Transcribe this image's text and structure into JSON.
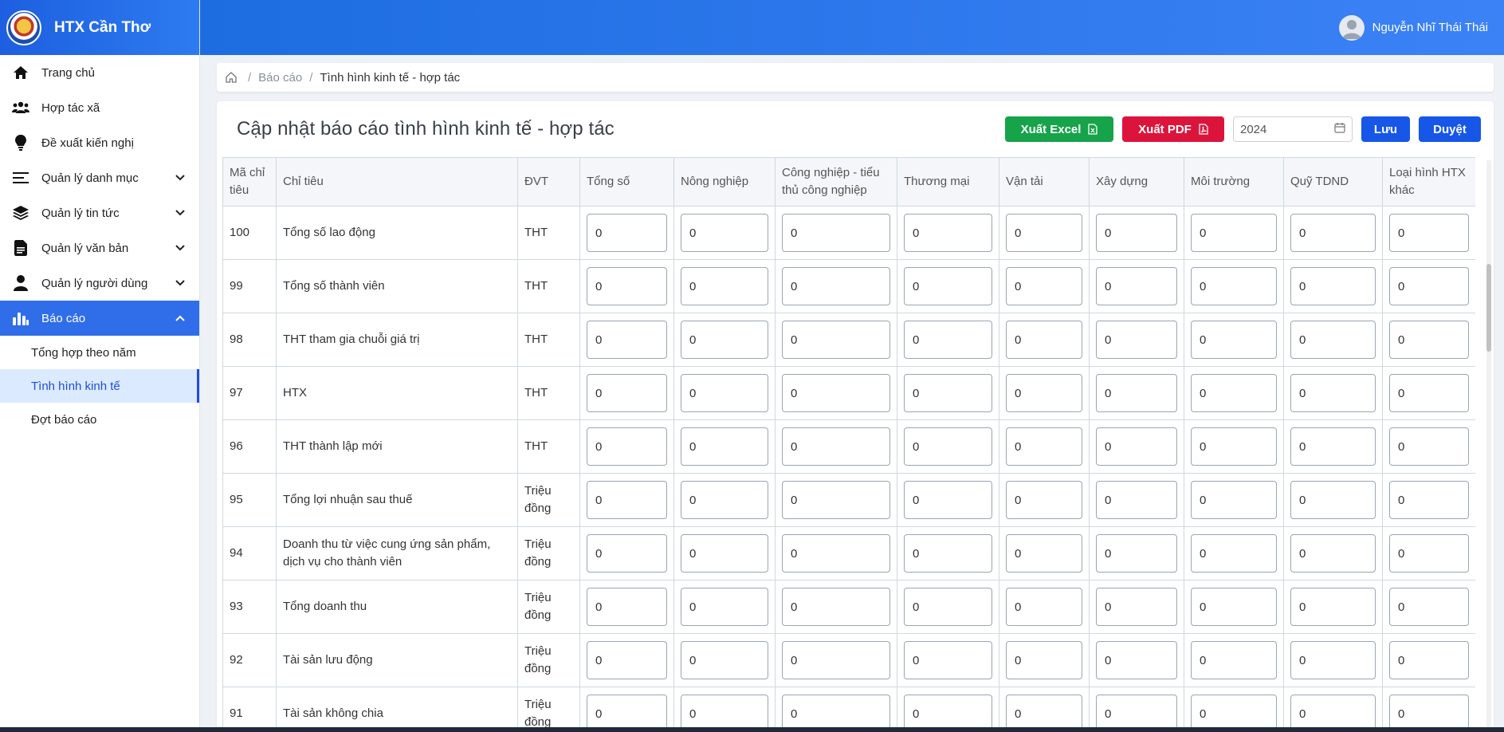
{
  "brand": {
    "name": "HTX Cần Thơ"
  },
  "user": {
    "name": "Nguyễn Nhĩ Thái Thái"
  },
  "sidebar": {
    "items": [
      {
        "label": "Trang chủ",
        "icon": "home-icon"
      },
      {
        "label": "Hợp tác xã",
        "icon": "users-icon"
      },
      {
        "label": "Đề xuất kiến nghị",
        "icon": "lightbulb-icon"
      },
      {
        "label": "Quản lý danh mục",
        "icon": "list-icon"
      },
      {
        "label": "Quản lý tin tức",
        "icon": "layers-icon"
      },
      {
        "label": "Quản lý văn bản",
        "icon": "document-icon"
      },
      {
        "label": "Quản lý người dùng",
        "icon": "user-icon"
      },
      {
        "label": "Báo cáo",
        "icon": "bar-chart-icon"
      }
    ],
    "sub_items": [
      {
        "label": "Tổng hợp theo năm"
      },
      {
        "label": "Tình hình kinh tế"
      },
      {
        "label": "Đợt báo cáo"
      }
    ]
  },
  "breadcrumb": {
    "link": "Báo cáo",
    "current": "Tình hình kinh tế - hợp tác",
    "sep": "/"
  },
  "page": {
    "title": "Cập nhật báo cáo tình hình kinh tế - hợp tác",
    "export_excel": "Xuất Excel",
    "export_pdf": "Xuất PDF",
    "year": "2024",
    "save": "Lưu",
    "approve": "Duyệt"
  },
  "colors": {
    "primary": "#1657e8",
    "excel": "#16a34a",
    "pdf": "#dc143c",
    "active_sub_bg": "#dbeafe",
    "header_gradient_start": "#1d6de0"
  },
  "table": {
    "headers": [
      "Mã chỉ tiêu",
      "Chỉ tiêu",
      "ĐVT",
      "Tổng số",
      "Nông nghiệp",
      "Công nghiệp - tiểu thủ công nghiệp",
      "Thương mại",
      "Vận tải",
      "Xây dựng",
      "Môi trường",
      "Quỹ TDND",
      "Loại hình HTX khác"
    ],
    "rows": [
      {
        "code": "100",
        "name": "Tổng số lao động",
        "unit": "THT",
        "values": [
          "0",
          "0",
          "0",
          "0",
          "0",
          "0",
          "0",
          "0",
          "0"
        ]
      },
      {
        "code": "99",
        "name": "Tổng số thành viên",
        "unit": "THT",
        "values": [
          "0",
          "0",
          "0",
          "0",
          "0",
          "0",
          "0",
          "0",
          "0"
        ]
      },
      {
        "code": "98",
        "name": "THT tham gia chuỗi giá trị",
        "unit": "THT",
        "values": [
          "0",
          "0",
          "0",
          "0",
          "0",
          "0",
          "0",
          "0",
          "0"
        ]
      },
      {
        "code": "97",
        "name": "HTX",
        "unit": "THT",
        "values": [
          "0",
          "0",
          "0",
          "0",
          "0",
          "0",
          "0",
          "0",
          "0"
        ]
      },
      {
        "code": "96",
        "name": "THT thành lập mới",
        "unit": "THT",
        "values": [
          "0",
          "0",
          "0",
          "0",
          "0",
          "0",
          "0",
          "0",
          "0"
        ]
      },
      {
        "code": "95",
        "name": "Tổng lợi nhuận sau thuế",
        "unit": "Triệu đồng",
        "values": [
          "0",
          "0",
          "0",
          "0",
          "0",
          "0",
          "0",
          "0",
          "0"
        ]
      },
      {
        "code": "94",
        "name": "Doanh thu từ việc cung ứng sản phẩm, dịch vụ cho thành viên",
        "unit": "Triệu đồng",
        "values": [
          "0",
          "0",
          "0",
          "0",
          "0",
          "0",
          "0",
          "0",
          "0"
        ]
      },
      {
        "code": "93",
        "name": "Tổng doanh thu",
        "unit": "Triệu đồng",
        "values": [
          "0",
          "0",
          "0",
          "0",
          "0",
          "0",
          "0",
          "0",
          "0"
        ]
      },
      {
        "code": "92",
        "name": "Tài sản lưu động",
        "unit": "Triệu đồng",
        "values": [
          "0",
          "0",
          "0",
          "0",
          "0",
          "0",
          "0",
          "0",
          "0"
        ]
      },
      {
        "code": "91",
        "name": "Tài sản không chia",
        "unit": "Triệu đồng",
        "values": [
          "0",
          "0",
          "0",
          "0",
          "0",
          "0",
          "0",
          "0",
          "0"
        ]
      }
    ]
  }
}
